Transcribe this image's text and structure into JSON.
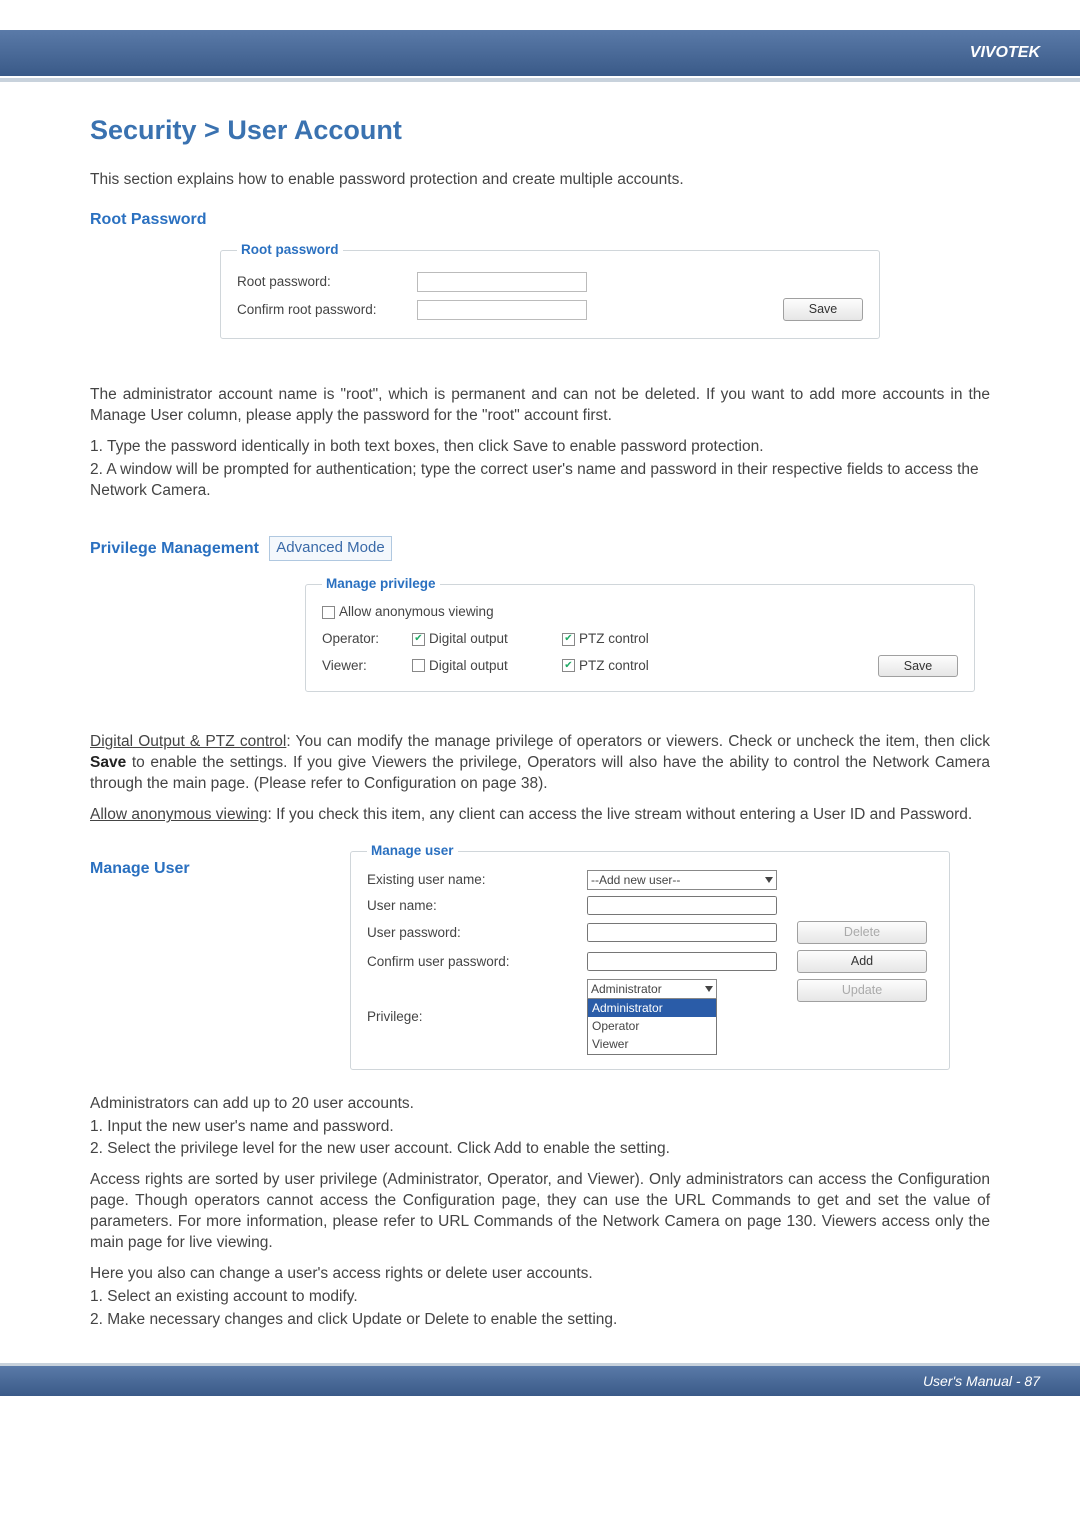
{
  "brand": "VIVOTEK",
  "page_title": "Security > User Account",
  "intro": "This section explains how to enable password protection and create multiple accounts.",
  "root_password": {
    "heading": "Root Password",
    "legend": "Root password",
    "root_pw_label": "Root password:",
    "confirm_pw_label": "Confirm root password:",
    "save_label": "Save"
  },
  "root_password_body": {
    "p1": "The administrator account name is \"root\", which is permanent and can not be deleted. If you want to add more accounts in the Manage User column, please apply the password for the \"root\" account first.",
    "li1_pre": "1. Type the password identically in both text boxes, then click ",
    "li1_bold": "Save",
    "li1_post": " to enable password protection.",
    "li2": "2. A window will be prompted for authentication; type the correct user's name and password in their respective fields to access the Network Camera."
  },
  "privilege": {
    "heading": "Privilege Management",
    "advanced_label": "Advanced Mode",
    "legend": "Manage privilege",
    "allow_anon": "Allow anonymous viewing",
    "operator_label": "Operator:",
    "viewer_label": "Viewer:",
    "digital_output": "Digital output",
    "ptz_control": "PTZ control",
    "save_label": "Save"
  },
  "privilege_body": {
    "dop_title": "Digital Output & PTZ control",
    "dop_text_pre": ": You can modify the manage privilege of operators or viewers. Check or uncheck the item, then click ",
    "dop_text_bold": "Save",
    "dop_text_post": " to enable the settings. If you give Viewers the privilege, Operators will also have the ability to control the Network Camera through the main page. (Please refer to Configuration on page 38).",
    "anon_title": "Allow anonymous viewing",
    "anon_text": ": If you check this item, any client can access the live stream without entering a User ID and Password."
  },
  "manage_user": {
    "heading": "Manage User",
    "legend": "Manage user",
    "existing_label": "Existing user name:",
    "existing_value": "--Add new user--",
    "username_label": "User name:",
    "password_label": "User password:",
    "confirm_label": "Confirm user password:",
    "privilege_label": "Privilege:",
    "privilege_value": "Administrator",
    "privilege_options": [
      "Administrator",
      "Operator",
      "Viewer"
    ],
    "delete_label": "Delete",
    "add_label": "Add",
    "update_label": "Update"
  },
  "manage_user_body": {
    "p1": "Administrators can add up to 20 user accounts.",
    "li1": "1. Input the new user's name and password.",
    "li2_pre": "2. Select the privilege level for the new user account. Click ",
    "li2_bold": "Add",
    "li2_post": " to enable the setting.",
    "p2": "Access rights are sorted by user privilege (Administrator, Operator, and Viewer). Only administrators can access the Configuration page. Though operators cannot access the Configuration page, they can use the URL Commands to get and set the value of parameters. For more information, please refer to URL Commands of the Network Camera on page 130. Viewers access only the main page for live viewing.",
    "p3": "Here you also can change a user's access rights or delete user accounts.",
    "li3": "1. Select an existing account to modify.",
    "li4_pre": "2. Make necessary changes and click ",
    "li4_b1": "Update",
    "li4_mid": " or ",
    "li4_b2": "Delete",
    "li4_post": " to enable the setting."
  },
  "footer": "User's Manual - 87"
}
